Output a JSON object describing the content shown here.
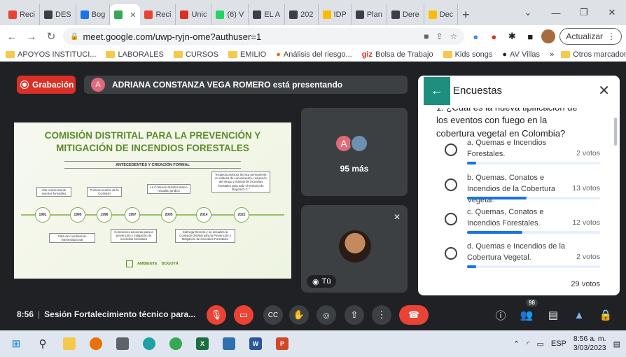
{
  "browser": {
    "tabs": [
      {
        "label": "Reci",
        "color": "#ea4335"
      },
      {
        "label": "DES",
        "color": "#3c4043"
      },
      {
        "label": "Bog",
        "color": "#1a73e8"
      },
      {
        "label": "",
        "color": "#34a853"
      },
      {
        "label": "Reci",
        "color": "#ea4335"
      },
      {
        "label": "Unic",
        "color": "#d93025"
      },
      {
        "label": "(6) V",
        "color": "#25d366"
      },
      {
        "label": "EL A",
        "color": "#3c4043"
      },
      {
        "label": "202",
        "color": "#3c4043"
      },
      {
        "label": "IDP",
        "color": "#fbbc04"
      },
      {
        "label": "Plan",
        "color": "#3c4043"
      },
      {
        "label": "Dere",
        "color": "#3c4043"
      },
      {
        "label": "Dec",
        "color": "#fbbc04"
      }
    ],
    "url": "meet.google.com/uwp-ryjn-ome?authuser=1",
    "update_label": "Actualizar",
    "bookmarks": [
      {
        "label": "APOYOS INSTITUCI...",
        "icon": "folder"
      },
      {
        "label": "LABORALES",
        "icon": "folder"
      },
      {
        "label": "CURSOS",
        "icon": "folder"
      },
      {
        "label": "EMILIO",
        "icon": "folder"
      },
      {
        "label": "Análisis del riesgo...",
        "icon": "site"
      },
      {
        "label": "Bolsa de Trabajo",
        "icon": "giz"
      },
      {
        "label": "Kids songs",
        "icon": "folder"
      },
      {
        "label": "AV Villas",
        "icon": "site"
      }
    ],
    "bookmarks_more": "»",
    "other_bookmarks": "Otros marcadores"
  },
  "meet": {
    "recording_label": "Grabación",
    "presenter_initial": "A",
    "presenting_text": "ADRIANA CONSTANZA VEGA ROMERO está presentando",
    "slide": {
      "title_line1": "COMISIÓN DISTRITAL PARA LA PREVENCIÓN Y",
      "title_line2": "MITIGACIÓN DE INCENDIOS FORESTALES",
      "subtitle": "ANTECEDENTES Y CREACIÓN FORMAL",
      "years": [
        "1991",
        "1995",
        "1996",
        "1997",
        "2005",
        "2014",
        "2022"
      ],
      "notes_top": [
        "Alta ocurrencia de eventos forestales",
        "Primera reunión de la Comisión",
        "La Comisión Distrital obtuvo respaldo jurídico",
        "\"Instancia asesora técnica permanente, en materia de conocimiento, reducción del riesgo y manejo de incendios forestales para todo el territorio de Bogotá D.C.\""
      ],
      "notes_bottom": [
        "Falta de coordinación interinstitucional",
        "Comisiones asesoras para la prevención y mitigación de incendios forestales",
        "Subroga Decreto y se actualiza la Comisión Distrital para la Prevención y Mitigación de Incendios Forestales"
      ],
      "footer_ambiente": "AMBIENTE",
      "footer_bogota": "BOGOTÁ"
    },
    "tile_initial": "A",
    "more_label": "95 más",
    "self_label": "Tú",
    "meeting_time": "8:56",
    "meeting_title": "Sesión Fortalecimiento técnico para...",
    "participant_count": "98"
  },
  "polls": {
    "title": "Encuestas",
    "question_cut": "1. ¿Cuál es la nueva tipificación de",
    "question": "los eventos con fuego en la cobertura vegetal en Colombia?",
    "options": [
      {
        "text": "a. Quemas e Incendios Forestales.",
        "votes_label": "2 votos",
        "fraction": 0.069
      },
      {
        "text": "b. Quemas, Conatos e Incendios de la Cobertura Vegetal.",
        "votes_label": "13 votos",
        "fraction": 0.448
      },
      {
        "text": "c. Quemas, Conatos e Incendios Forestales.",
        "votes_label": "12 votos",
        "fraction": 0.414
      },
      {
        "text": "d. Quemas e Incendios de la Cobertura Vegetal.",
        "votes_label": "2 votos",
        "fraction": 0.069
      }
    ],
    "total_label": "29 votos"
  },
  "taskbar": {
    "language": "ESP",
    "time": "8:56 a. m.",
    "date": "3/03/2023"
  }
}
